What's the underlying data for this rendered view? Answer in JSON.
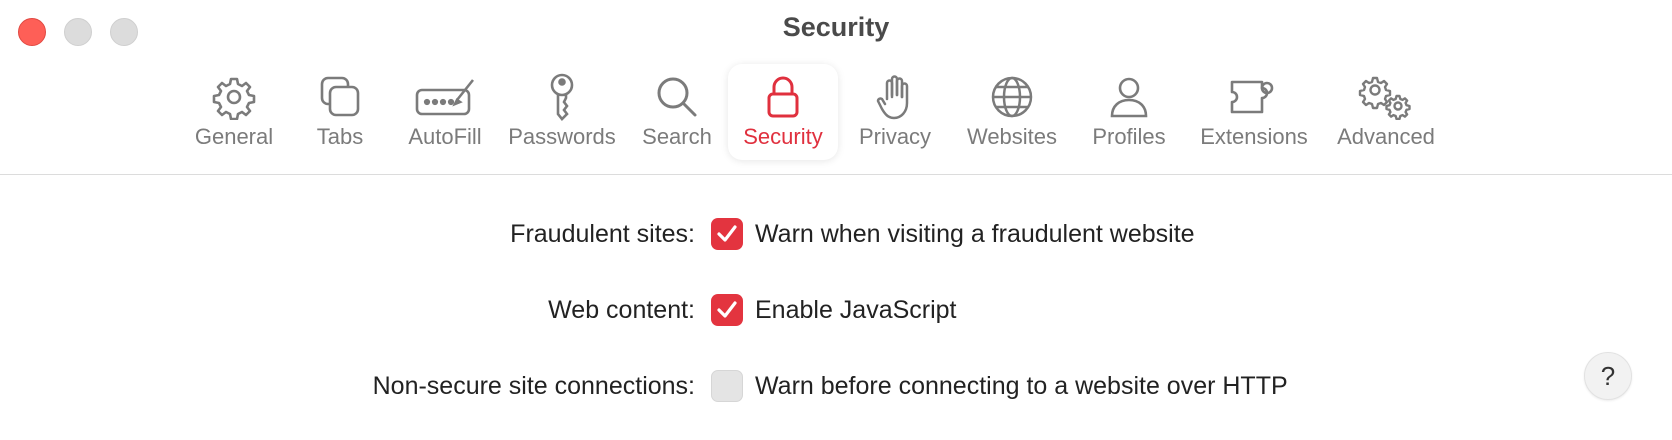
{
  "window": {
    "title": "Security"
  },
  "toolbar": {
    "tabs": [
      {
        "label": "General",
        "icon": "gear-icon",
        "active": false
      },
      {
        "label": "Tabs",
        "icon": "tabs-icon",
        "active": false
      },
      {
        "label": "AutoFill",
        "icon": "autofill-icon",
        "active": false
      },
      {
        "label": "Passwords",
        "icon": "key-icon",
        "active": false
      },
      {
        "label": "Search",
        "icon": "search-icon",
        "active": false
      },
      {
        "label": "Security",
        "icon": "lock-icon",
        "active": true
      },
      {
        "label": "Privacy",
        "icon": "hand-icon",
        "active": false
      },
      {
        "label": "Websites",
        "icon": "globe-icon",
        "active": false
      },
      {
        "label": "Profiles",
        "icon": "person-icon",
        "active": false
      },
      {
        "label": "Extensions",
        "icon": "puzzle-icon",
        "active": false
      },
      {
        "label": "Advanced",
        "icon": "gears-icon",
        "active": false
      }
    ]
  },
  "settings": {
    "rows": [
      {
        "label": "Fraudulent sites:",
        "option": "Warn when visiting a fraudulent website",
        "checked": true
      },
      {
        "label": "Web content:",
        "option": "Enable JavaScript",
        "checked": true
      },
      {
        "label": "Non-secure site connections:",
        "option": "Warn before connecting to a website over HTTP",
        "checked": false
      }
    ]
  },
  "help": {
    "label": "?"
  },
  "colors": {
    "accent": "#e3343f",
    "close": "#fe5f57",
    "inactive_traffic": "#dcdcdc"
  }
}
